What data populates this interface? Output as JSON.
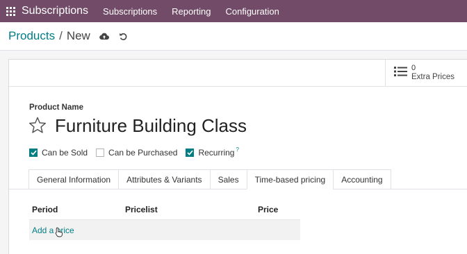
{
  "navbar": {
    "app_name": "Subscriptions",
    "menu": [
      "Subscriptions",
      "Reporting",
      "Configuration"
    ],
    "color": "#714b67"
  },
  "breadcrumb": {
    "parent": "Products",
    "separator": "/",
    "current": "New"
  },
  "smart_button": {
    "value": "0",
    "label": "Extra Prices",
    "icon": "list-icon"
  },
  "product": {
    "name_label": "Product Name",
    "name": "Furniture Building Class"
  },
  "options": [
    {
      "label": "Can be Sold",
      "checked": true
    },
    {
      "label": "Can be Purchased",
      "checked": false
    },
    {
      "label": "Recurring",
      "checked": true,
      "help": "?"
    }
  ],
  "tabs": [
    "General Information",
    "Attributes & Variants",
    "Sales",
    "Time-based pricing",
    "Accounting"
  ],
  "active_tab": "Time-based pricing",
  "pricing_table": {
    "columns": [
      "Period",
      "Pricelist",
      "Price"
    ],
    "add_label": "Add a price"
  },
  "accent": "#017e84"
}
